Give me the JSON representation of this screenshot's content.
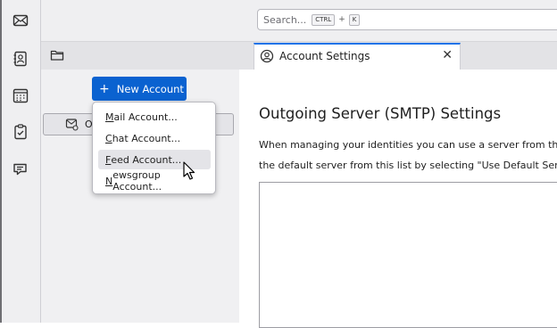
{
  "spaces_toolbar": {
    "icons": [
      "mail-icon",
      "address-book-icon",
      "calendar-icon",
      "tasks-icon",
      "chat-icon"
    ]
  },
  "search": {
    "placeholder": "Search...",
    "shortcut_key1": "CTRL",
    "shortcut_plus": "+",
    "shortcut_key2": "K"
  },
  "tab": {
    "label": "Account Settings",
    "close": "✕"
  },
  "account_pane": {
    "new_account_label": "New Account",
    "new_account_plus": "+",
    "account_row_label": "O"
  },
  "menu": {
    "items": [
      {
        "key": "M",
        "rest": "ail Account..."
      },
      {
        "key": "C",
        "rest": "hat Account..."
      },
      {
        "key": "F",
        "rest": "eed Account..."
      },
      {
        "key": "N",
        "rest": "ewsgroup Account..."
      }
    ],
    "hovered_index": 2
  },
  "content": {
    "heading": "Outgoing Server (SMTP) Settings",
    "desc_line1": "When managing your identities you can use a server from this",
    "desc_line2": "the default server from this list by selecting \"Use Default Serve"
  },
  "colors": {
    "accent": "#0a62d0",
    "tab_indicator": "#1a73e8"
  }
}
